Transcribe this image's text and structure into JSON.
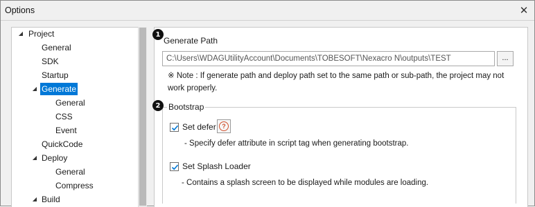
{
  "window": {
    "title": "Options",
    "close_glyph": "✕"
  },
  "tree": [
    {
      "label": "Project",
      "arrow": "◢",
      "level": 0
    },
    {
      "label": "General",
      "level": 1
    },
    {
      "label": "SDK",
      "level": 1
    },
    {
      "label": "Startup",
      "level": 1
    },
    {
      "label": "Generate",
      "arrow": "◢",
      "level": 1,
      "selected": true
    },
    {
      "label": "General",
      "level": 2
    },
    {
      "label": "CSS",
      "level": 2
    },
    {
      "label": "Event",
      "level": 2
    },
    {
      "label": "QuickCode",
      "level": 1
    },
    {
      "label": "Deploy",
      "arrow": "◢",
      "level": 1
    },
    {
      "label": "General",
      "level": 2
    },
    {
      "label": "Compress",
      "level": 2
    },
    {
      "label": "Build",
      "arrow": "◢",
      "level": 1
    }
  ],
  "generate": {
    "marker": "1",
    "label": "Generate Path",
    "path_value": "C:\\Users\\WDAGUtilityAccount\\Documents\\TOBESOFT\\Nexacro N\\outputs\\TEST",
    "browse_label": "...",
    "note": "※ Note : If generate path and deploy path set to the same path or sub-path, the project may not work properly."
  },
  "bootstrap": {
    "marker": "2",
    "legend": "Bootstrap",
    "set_defer": {
      "label": "Set defer",
      "checked": true,
      "help_glyph": "?",
      "description": "- Specify defer attribute in script tag when generating bootstrap."
    },
    "splash": {
      "label": "Set Splash Loader",
      "checked": true,
      "description": "- Contains a splash screen to be displayed while modules are loading."
    }
  },
  "colors": {
    "selection": "#0078d7",
    "help_accent": "#d0502d",
    "check": "#0078d7"
  }
}
